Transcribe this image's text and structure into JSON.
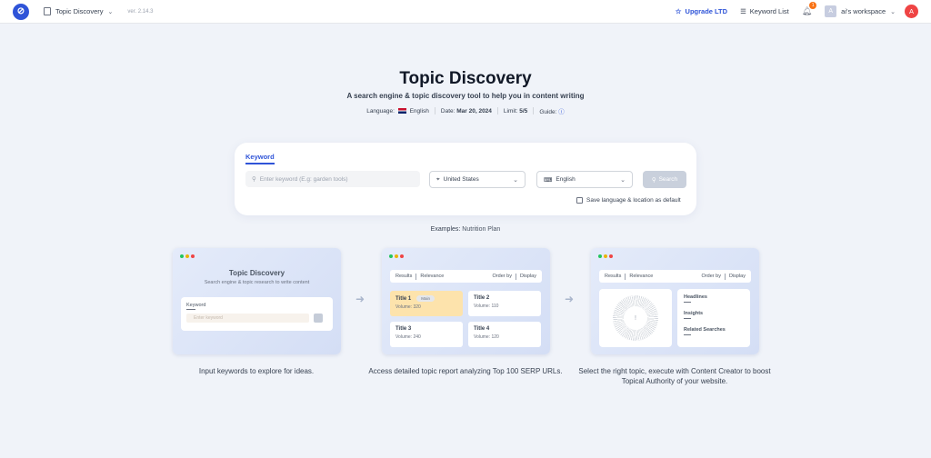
{
  "header": {
    "app_name": "Topic Discovery",
    "version": "ver. 2.14.3",
    "upgrade_label": "Upgrade LTD",
    "keyword_list_label": "Keyword List",
    "notification_count": "1",
    "workspace_initial": "A",
    "workspace_name": "ai's workspace",
    "user_initial": "A"
  },
  "hero": {
    "title": "Topic Discovery",
    "subtitle": "A search engine & topic discovery tool to help you in content writing",
    "language_label": "Language:",
    "language_value": "English",
    "date_label": "Date:",
    "date_value": "Mar 20, 2024",
    "limit_label": "Limit:",
    "limit_value": "5/5",
    "guide_label": "Guide:"
  },
  "search": {
    "tab_label": "Keyword",
    "placeholder": "Enter keyword (E.g: garden tools)",
    "location": "United States",
    "language": "English",
    "button_label": "Search",
    "save_pref_label": "Save language & location as default"
  },
  "examples": {
    "label": "Examples:",
    "item": "Nutrition Plan"
  },
  "steps": [
    {
      "title": "Topic Discovery",
      "subtitle": "Search engine & topic research to write content",
      "kw_label": "Keyword",
      "input_placeholder": "Enter keyword",
      "caption": "Input keywords to explore for ideas."
    },
    {
      "results": "Results",
      "relevance": "Relevance",
      "order_by": "Order by",
      "display": "Display",
      "tiles": [
        {
          "title": "Title 1",
          "badge": "Main",
          "volume": "Volume: 320"
        },
        {
          "title": "Title 2",
          "volume": "Volume: 110"
        },
        {
          "title": "Title 3",
          "volume": "Volume: 240"
        },
        {
          "title": "Title 4",
          "volume": "Volume: 120"
        }
      ],
      "caption": "Access detailed topic report analyzing Top 100 SERP URLs."
    },
    {
      "results": "Results",
      "relevance": "Relevance",
      "order_by": "Order by",
      "display": "Display",
      "list": [
        "Headlines",
        "Insights",
        "Related Searches"
      ],
      "caption": "Select the right topic, execute with Content Creator to boost Topical Authority of your website."
    }
  ],
  "colors": {
    "accent": "#2f54d8",
    "background": "#f0f3f9",
    "dot_green": "#22c55e",
    "dot_yellow": "#eab308",
    "dot_red": "#ef4444"
  }
}
